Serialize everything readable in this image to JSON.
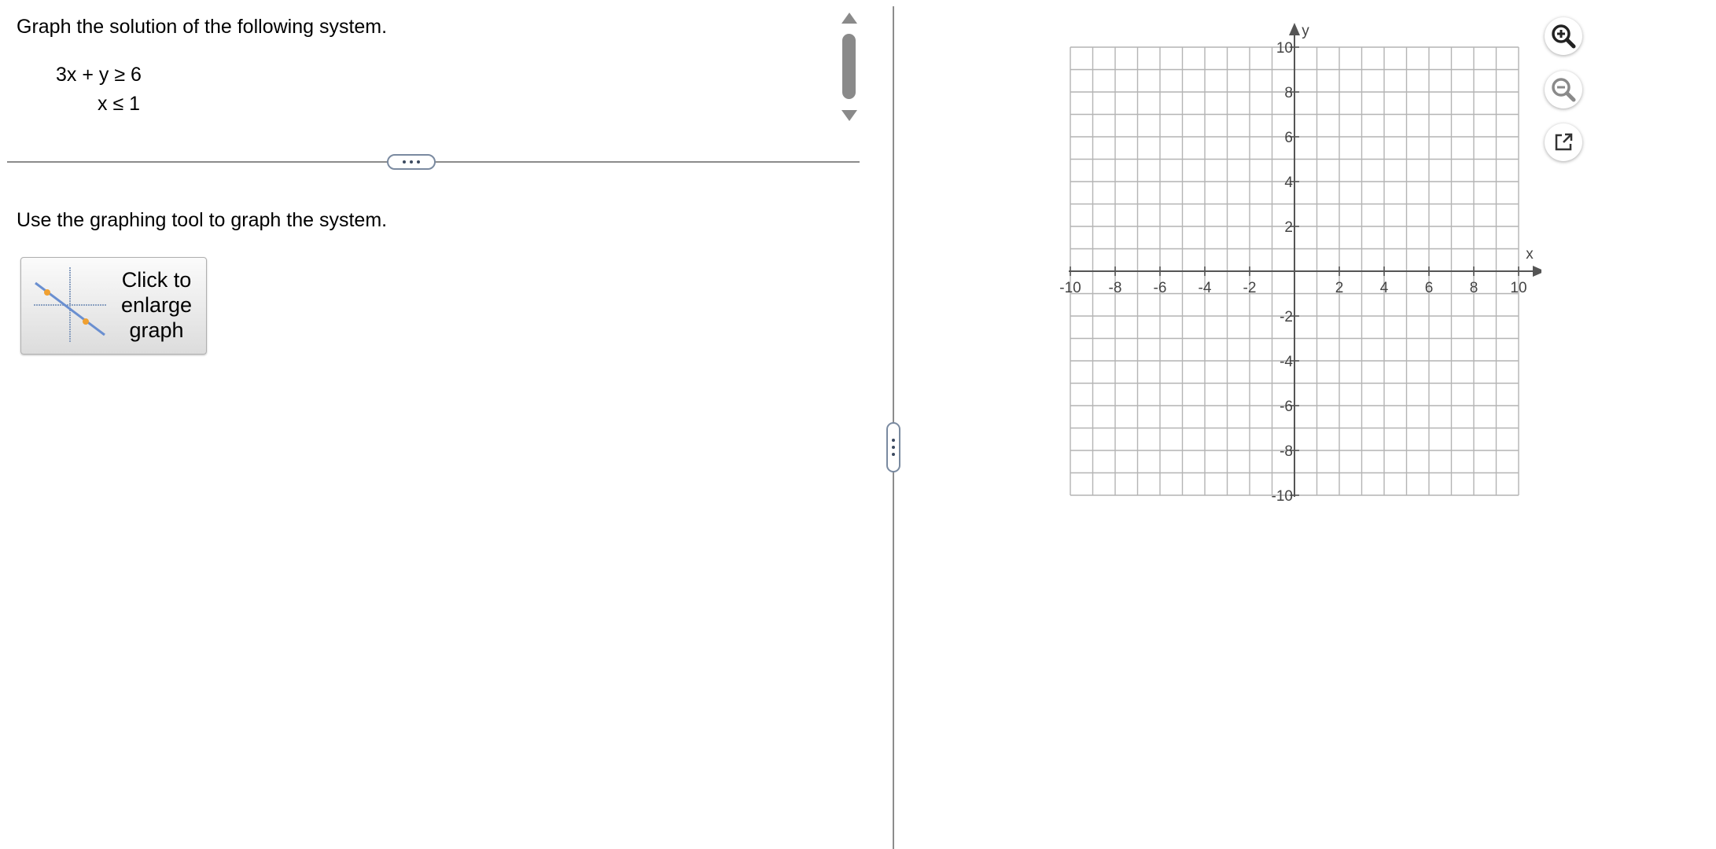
{
  "question": {
    "prompt": "Graph the solution of the following system.",
    "inequalities": [
      "3x + y ≥ 6",
      "x ≤ 1"
    ],
    "instruction": "Use the graphing tool to graph the system."
  },
  "enlarge_button": {
    "label_lines": [
      "Click to",
      "enlarge",
      "graph"
    ]
  },
  "graph": {
    "x_axis_label": "x",
    "y_axis_label": "y",
    "x_range": [
      -10,
      10
    ],
    "y_range": [
      -10,
      10
    ],
    "grid_step": 1,
    "x_tick_labels": [
      "-10",
      "-8",
      "-6",
      "-4",
      "-2",
      "2",
      "4",
      "6",
      "8",
      "10"
    ],
    "y_tick_labels": [
      "10",
      "8",
      "6",
      "4",
      "2",
      "-2",
      "-4",
      "-6",
      "-8",
      "-10"
    ]
  },
  "toolbar": {
    "zoom_in_icon": "zoom-in-icon",
    "zoom_out_icon": "zoom-out-icon",
    "popout_icon": "popout-icon"
  },
  "colors": {
    "grid": "#b4b4b4",
    "axis": "#555555",
    "zoom_in": "#222222",
    "zoom_out": "#8a8a8a",
    "thumb_point": "#f0a030",
    "thumb_line": "#6a8fd0"
  }
}
